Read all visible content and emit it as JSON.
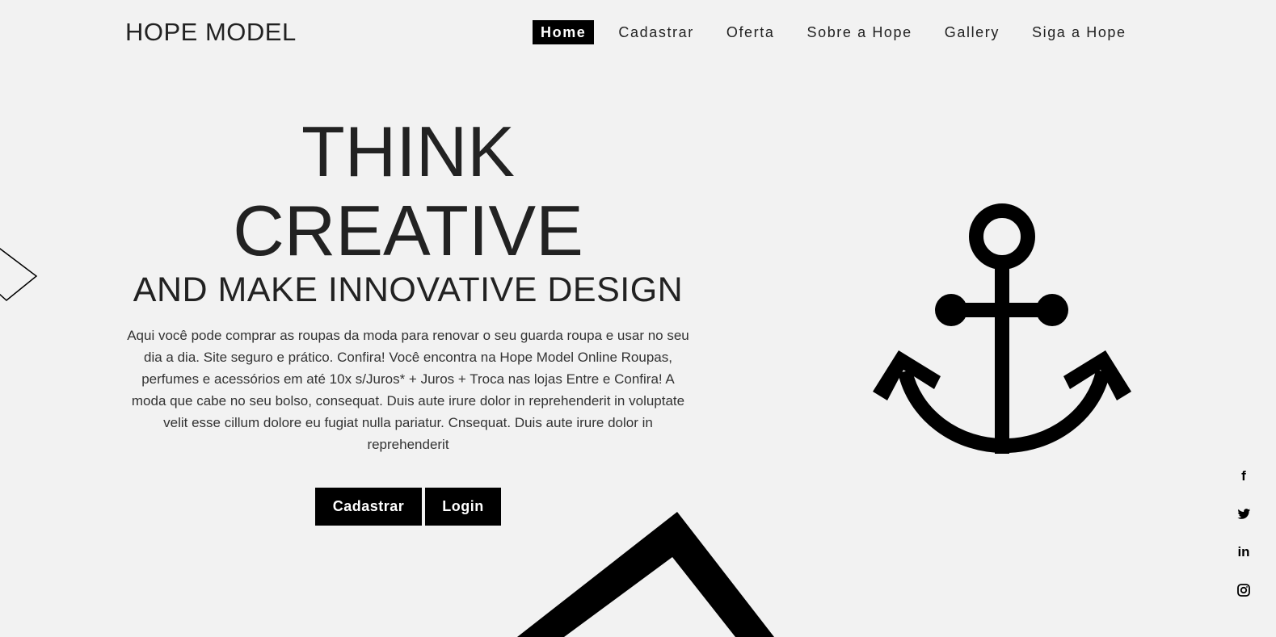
{
  "brand": {
    "logo": "HOPE MODEL"
  },
  "nav": {
    "items": [
      {
        "label": "Home",
        "active": true
      },
      {
        "label": "Cadastrar"
      },
      {
        "label": "Oferta"
      },
      {
        "label": "Sobre a Hope"
      },
      {
        "label": "Gallery"
      },
      {
        "label": "Siga a Hope"
      }
    ]
  },
  "hero": {
    "line1": "THINK",
    "line2": "CREATIVE",
    "line3": "AND MAKE INNOVATIVE DESIGN",
    "description": "Aqui você pode comprar as roupas da moda para renovar o seu guarda roupa e usar no seu dia a dia. Site seguro e prático. Confira! Você encontra na Hope Model Online Roupas, perfumes e acessórios em até 10x s/Juros* + Juros + Troca nas lojas Entre e Confira! A moda que cabe no seu bolso, consequat. Duis aute irure dolor in reprehenderit in voluptate velit esse cillum dolore eu fugiat nulla pariatur. Cnsequat. Duis aute irure dolor in reprehenderit",
    "btn_primary": "Cadastrar",
    "btn_secondary": "Login"
  },
  "social": {
    "facebook": "f",
    "linkedin": "in"
  },
  "colors": {
    "background": "#f2f2f2",
    "accent": "#000000",
    "text": "#222222"
  },
  "icons": [
    "anchor-icon",
    "facebook-icon",
    "twitter-icon",
    "linkedin-icon",
    "instagram-icon"
  ]
}
